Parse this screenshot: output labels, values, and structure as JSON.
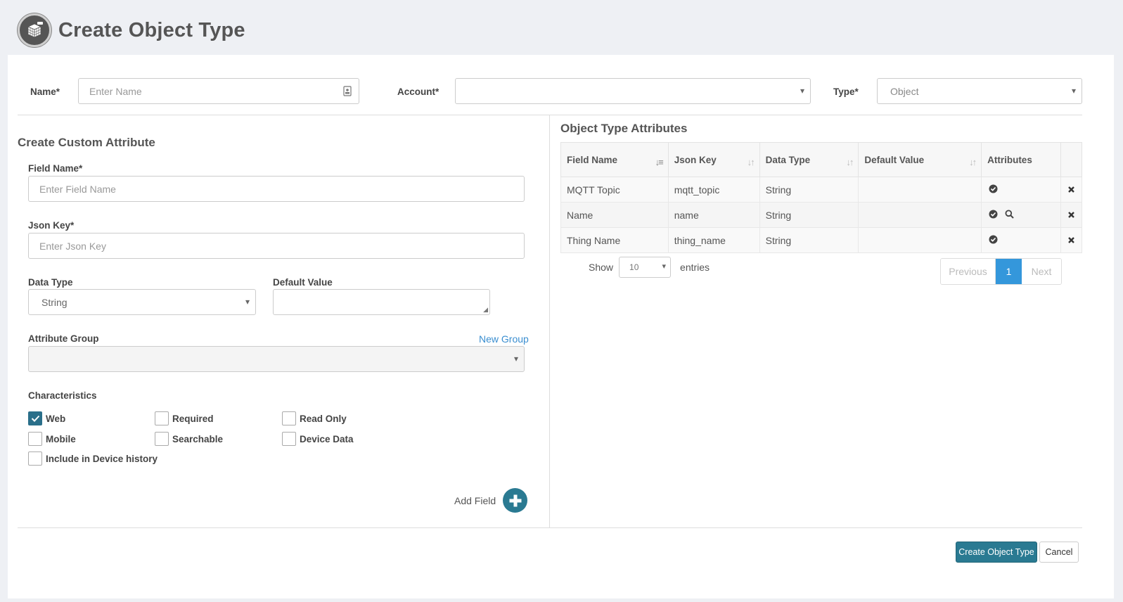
{
  "header": {
    "title": "Create Object Type",
    "icon": "database-cube-icon"
  },
  "top_form": {
    "name_label": "Name*",
    "name_placeholder": "Enter Name",
    "account_label": "Account*",
    "account_value": "",
    "type_label": "Type*",
    "type_value": "Object"
  },
  "custom_attribute": {
    "title": "Create Custom Attribute",
    "field_name_label": "Field Name*",
    "field_name_placeholder": "Enter Field Name",
    "json_key_label": "Json Key*",
    "json_key_placeholder": "Enter Json Key",
    "data_type_label": "Data Type",
    "data_type_value": "String",
    "default_value_label": "Default Value",
    "default_value_value": "",
    "attribute_group_label": "Attribute Group",
    "new_group_link": "New Group",
    "characteristics_label": "Characteristics",
    "characteristics": [
      {
        "label": "Web",
        "checked": true
      },
      {
        "label": "Required",
        "checked": false
      },
      {
        "label": "Read Only",
        "checked": false
      },
      {
        "label": "Mobile",
        "checked": false
      },
      {
        "label": "Searchable",
        "checked": false
      },
      {
        "label": "Device Data",
        "checked": false
      },
      {
        "label": "Include in Device history",
        "checked": false
      }
    ],
    "add_field_label": "Add Field"
  },
  "attributes_table": {
    "title": "Object Type Attributes",
    "columns": [
      "Field Name",
      "Json Key",
      "Data Type",
      "Default Value",
      "Attributes"
    ],
    "rows": [
      {
        "field_name": "MQTT Topic",
        "json_key": "mqtt_topic",
        "data_type": "String",
        "default_value": "",
        "icons": [
          "check-circle-icon"
        ]
      },
      {
        "field_name": "Name",
        "json_key": "name",
        "data_type": "String",
        "default_value": "",
        "icons": [
          "check-circle-icon",
          "search-icon"
        ]
      },
      {
        "field_name": "Thing Name",
        "json_key": "thing_name",
        "data_type": "String",
        "default_value": "",
        "icons": [
          "check-circle-icon"
        ]
      }
    ],
    "show_label": "Show",
    "entries_value": "10",
    "entries_label": "entries",
    "pagination": {
      "previous": "Previous",
      "current": "1",
      "next": "Next"
    }
  },
  "footer": {
    "create_button": "Create Object Type",
    "cancel_button": "Cancel"
  },
  "colors": {
    "primary": "#2a7a92",
    "link": "#3a8ed0",
    "page_active": "#3497db"
  }
}
